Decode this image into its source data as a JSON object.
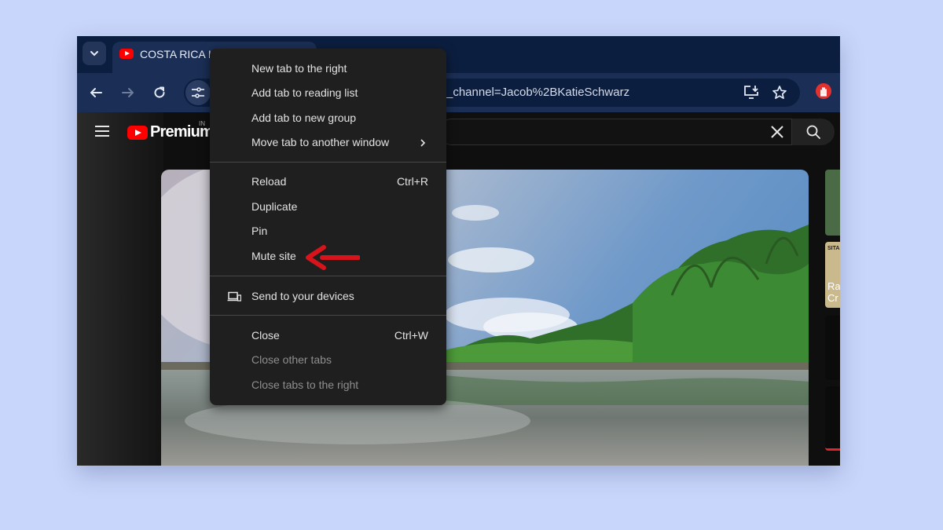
{
  "browser": {
    "tab": {
      "title": "COSTA RICA IN",
      "favicon": "youtube-icon"
    },
    "omnibox": {
      "visible_url": "_channel=Jacob%2BKatieSchwarz"
    },
    "colors": {
      "tabstrip": "#0c1e3f",
      "toolbar": "#1b2f56",
      "menu": "#1f1f1f",
      "backdrop": "#c9d6fb"
    }
  },
  "youtube": {
    "brand": "Premium",
    "region": "IN"
  },
  "sidebar_rail": {
    "badge": "SITA",
    "text": [
      "Ra",
      "Cr"
    ]
  },
  "context_menu": {
    "groups": [
      [
        {
          "label": "New tab to the right"
        },
        {
          "label": "Add tab to reading list"
        },
        {
          "label": "Add tab to new group"
        },
        {
          "label": "Move tab to another window",
          "submenu": true
        }
      ],
      [
        {
          "label": "Reload",
          "shortcut": "Ctrl+R"
        },
        {
          "label": "Duplicate"
        },
        {
          "label": "Pin"
        },
        {
          "label": "Mute site"
        }
      ],
      [
        {
          "label": "Send to your devices",
          "icon": "devices-icon"
        }
      ],
      [
        {
          "label": "Close",
          "shortcut": "Ctrl+W"
        },
        {
          "label": "Close other tabs",
          "disabled": true
        },
        {
          "label": "Close tabs to the right",
          "disabled": true
        }
      ]
    ]
  },
  "annotation": {
    "arrow_color": "#d7141b",
    "points_to": "Mute site"
  }
}
